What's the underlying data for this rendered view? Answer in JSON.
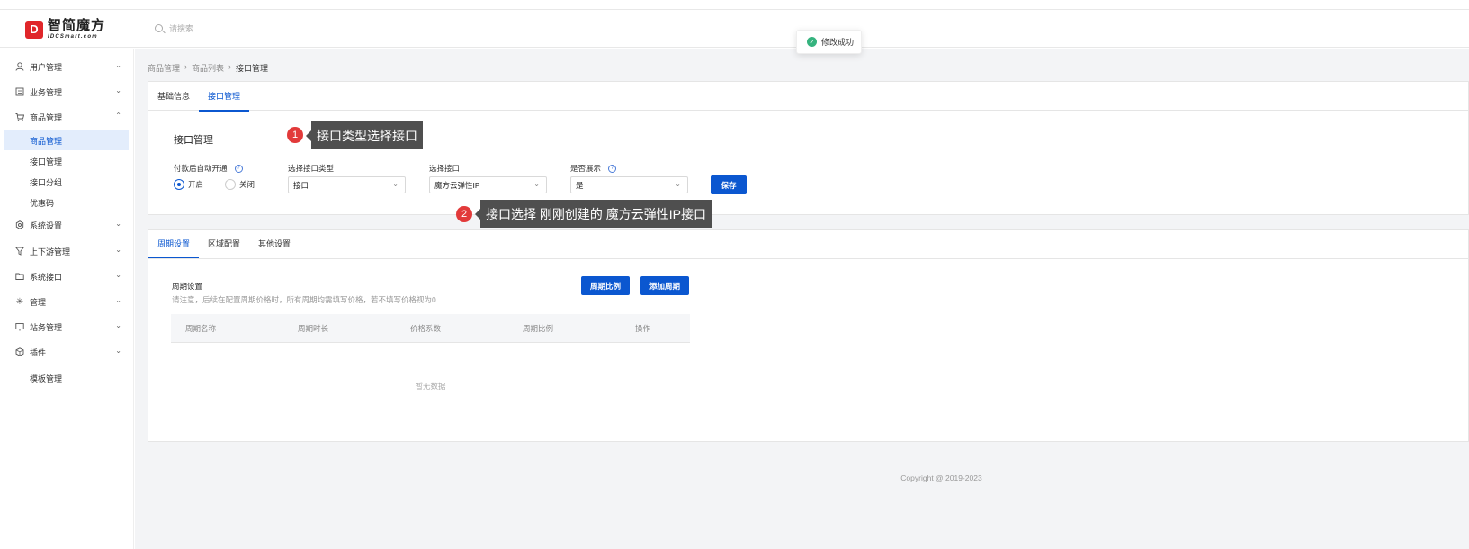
{
  "logo": {
    "mark": "D",
    "main": "智简魔方",
    "sub": "IDCSmart.com"
  },
  "search": {
    "placeholder": "请搜索"
  },
  "toast": {
    "text": "修改成功"
  },
  "sidebar": {
    "items": [
      {
        "label": "用户管理",
        "icon": "user-icon"
      },
      {
        "label": "业务管理",
        "icon": "document-icon"
      },
      {
        "label": "商品管理",
        "icon": "cart-icon",
        "expanded": true
      },
      {
        "label": "系统设置",
        "icon": "gear-icon"
      },
      {
        "label": "上下游管理",
        "icon": "filter-icon"
      },
      {
        "label": "系统接口",
        "icon": "folder-icon"
      },
      {
        "label": "管理",
        "icon": "sparkle-icon"
      },
      {
        "label": "站务管理",
        "icon": "station-icon"
      },
      {
        "label": "插件",
        "icon": "box-icon"
      },
      {
        "label": "模板管理",
        "icon": ""
      }
    ],
    "sub_items": [
      {
        "label": "商品管理",
        "active": true
      },
      {
        "label": "接口管理"
      },
      {
        "label": "接口分组"
      },
      {
        "label": "优惠码"
      }
    ]
  },
  "breadcrumb": {
    "level1": "商品管理",
    "level2": "商品列表",
    "current": "接口管理",
    "sep": "›"
  },
  "top_tabs": [
    {
      "label": "基础信息"
    },
    {
      "label": "接口管理",
      "active": true
    }
  ],
  "interface_section": {
    "title": "接口管理",
    "auto_open_label": "付款后自动开通",
    "radio_on": "开启",
    "radio_off": "关闭",
    "type_label": "选择接口类型",
    "type_value": "接口",
    "interface_label": "选择接口",
    "interface_value": "魔方云弹性IP",
    "show_label": "是否展示",
    "show_value": "是",
    "save_label": "保存"
  },
  "bottom_tabs": [
    {
      "label": "周期设置",
      "active": true
    },
    {
      "label": "区域配置"
    },
    {
      "label": "其他设置"
    }
  ],
  "cycle": {
    "title": "周期设置",
    "desc": "请注意，后续在配置周期价格时，所有周期均需填写价格，若不填写价格视为0",
    "ratio_button": "周期比例",
    "add_button": "添加周期",
    "columns": [
      "周期名称",
      "周期时长",
      "价格系数",
      "周期比例",
      "操作"
    ],
    "empty": "暂无数据"
  },
  "copyright": "Copyright @ 2019-2023",
  "annotations": [
    {
      "num": "1",
      "text": "接口类型选择接口"
    },
    {
      "num": "2",
      "text": "接口选择 刚刚创建的 魔方云弹性IP接口"
    }
  ],
  "colors": {
    "primary": "#0b57d0",
    "brand": "#e0262a",
    "success": "#35b37e",
    "annotation": "#e23a3a"
  }
}
